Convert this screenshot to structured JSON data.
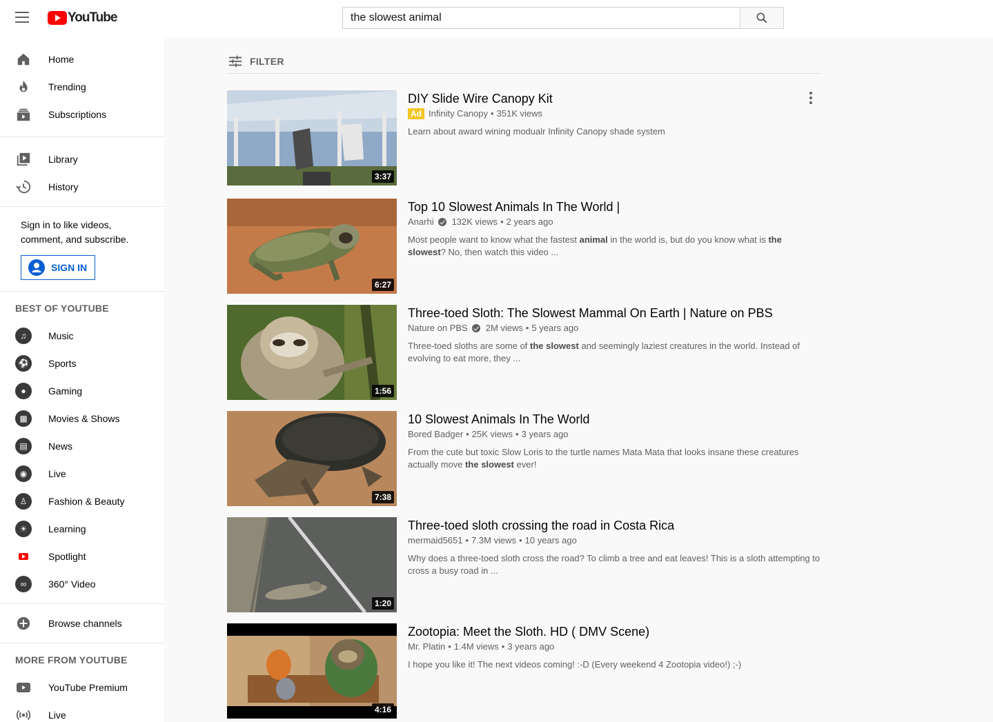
{
  "header": {
    "logo_text": "YouTube",
    "search_value": "the slowest animal"
  },
  "sidebar": {
    "primary": [
      {
        "label": "Home",
        "icon": "home-icon"
      },
      {
        "label": "Trending",
        "icon": "fire-icon"
      },
      {
        "label": "Subscriptions",
        "icon": "subscriptions-icon"
      }
    ],
    "library": [
      {
        "label": "Library",
        "icon": "library-icon"
      },
      {
        "label": "History",
        "icon": "history-icon"
      }
    ],
    "signin_text": "Sign in to like videos, comment, and subscribe.",
    "signin_button": "SIGN IN",
    "best_title": "BEST OF YOUTUBE",
    "best": [
      {
        "label": "Music",
        "icon": "music-icon"
      },
      {
        "label": "Sports",
        "icon": "sports-icon"
      },
      {
        "label": "Gaming",
        "icon": "gaming-icon"
      },
      {
        "label": "Movies & Shows",
        "icon": "movies-icon"
      },
      {
        "label": "News",
        "icon": "news-icon"
      },
      {
        "label": "Live",
        "icon": "live-icon"
      },
      {
        "label": "Fashion & Beauty",
        "icon": "fashion-icon"
      },
      {
        "label": "Learning",
        "icon": "learning-icon"
      },
      {
        "label": "Spotlight",
        "icon": "spotlight-icon"
      },
      {
        "label": "360° Video",
        "icon": "360-video-icon"
      }
    ],
    "browse_channels": "Browse channels",
    "more_title": "MORE FROM YOUTUBE",
    "more": [
      {
        "label": "YouTube Premium",
        "icon": "youtube-premium-icon"
      },
      {
        "label": "Live",
        "icon": "live-broadcast-icon"
      }
    ]
  },
  "filter_label": "FILTER",
  "results": [
    {
      "title": "DIY Slide Wire Canopy Kit",
      "is_ad": true,
      "ad_label": "Ad",
      "channel": "Infinity Canopy",
      "verified": false,
      "views": "351K views",
      "age": "",
      "duration": "3:37",
      "description_html": "Learn about award wining modualr Infinity Canopy shade system"
    },
    {
      "title": "Top 10 Slowest Animals In The World |",
      "is_ad": false,
      "channel": "Anarhi",
      "verified": true,
      "views": "132K views",
      "age": "2 years ago",
      "duration": "6:27",
      "description_html": "Most people want to know what the fastest <b>animal</b> in the world is, but do you know what is <b>the slowest</b>? No, then watch this video ..."
    },
    {
      "title": "Three-toed Sloth: The Slowest Mammal On Earth | Nature on PBS",
      "is_ad": false,
      "channel": "Nature on PBS",
      "verified": true,
      "views": "2M views",
      "age": "5 years ago",
      "duration": "1:56",
      "description_html": "Three-toed sloths are some of <b>the slowest</b> and seemingly laziest creatures in the world. Instead of evolving to eat more, they ..."
    },
    {
      "title": "10 Slowest Animals In The World",
      "is_ad": false,
      "channel": "Bored Badger",
      "verified": false,
      "views": "25K views",
      "age": "3 years ago",
      "duration": "7:38",
      "description_html": "From the cute but toxic Slow Loris to the turtle names Mata Mata that looks insane these creatures actually move <b>the slowest</b> ever!"
    },
    {
      "title": "Three-toed sloth crossing the road in Costa Rica",
      "is_ad": false,
      "channel": "mermaid5651",
      "verified": false,
      "views": "7.3M views",
      "age": "10 years ago",
      "duration": "1:20",
      "description_html": "Why does a three-toed sloth cross the road? To climb a tree and eat leaves! This is a sloth attempting to cross a busy road in ..."
    },
    {
      "title": "Zootopia: Meet the Sloth. HD ( DMV Scene)",
      "is_ad": false,
      "channel": "Mr. Platin",
      "verified": false,
      "views": "1.4M views",
      "age": "3 years ago",
      "duration": "4:16",
      "description_html": "I hope you like it! The next videos coming! :-D (Every weekend 4 Zootopia video!) ;-)"
    }
  ],
  "colors": {
    "brand_red": "#ff0000",
    "link_blue": "#065fd4",
    "ad_yellow": "#f2c624"
  }
}
